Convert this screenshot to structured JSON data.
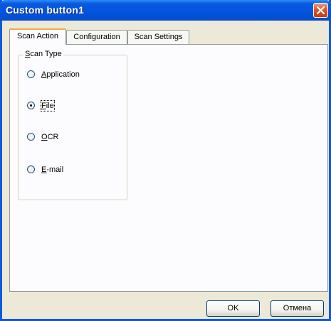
{
  "window": {
    "title": "Custom button1"
  },
  "tabs": [
    {
      "label": "Scan Action",
      "selected": true
    },
    {
      "label": "Configuration",
      "selected": false
    },
    {
      "label": "Scan Settings",
      "selected": false
    }
  ],
  "scan_type": {
    "label_underlined": "S",
    "label_rest": "can Type",
    "options": [
      {
        "underlined": "A",
        "rest": "pplication",
        "selected": false
      },
      {
        "underlined": "F",
        "rest": "ile",
        "selected": true
      },
      {
        "underlined": "O",
        "rest": "CR",
        "selected": false
      },
      {
        "underlined": "E",
        "rest": "-mail",
        "selected": false
      }
    ]
  },
  "buttons": {
    "ok_label": "OK",
    "cancel_label": "Отмена"
  },
  "colors": {
    "titlebar": "#0355e0",
    "close_button": "#d8572a",
    "dialog_bg": "#ece9d8",
    "active_tab_accent": "#f1a94a"
  }
}
